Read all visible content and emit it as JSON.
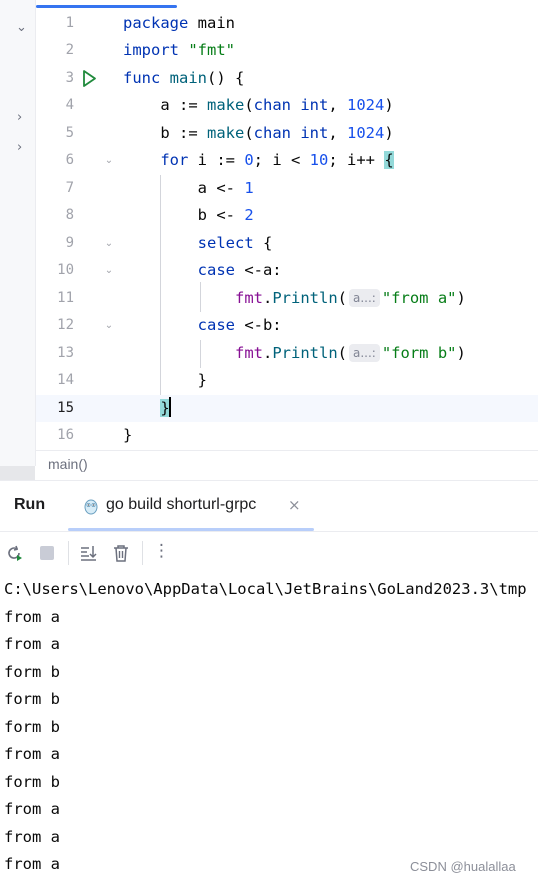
{
  "editor": {
    "line_numbers": [
      "1",
      "2",
      "3",
      "4",
      "5",
      "6",
      "7",
      "8",
      "9",
      "10",
      "11",
      "12",
      "13",
      "14",
      "15",
      "16"
    ],
    "active_line": "15",
    "breadcrumb": "main()",
    "hints": {
      "param_hint": "a...:"
    },
    "code": {
      "l1_kw": "package",
      "l1_rest": " main",
      "l2_kw": "import",
      "l2_str": " \"fmt\"",
      "l3_kw": "func",
      "l3_fn": " main",
      "l3_rest": "() {",
      "l4_a": "    a := ",
      "l4_make": "make",
      "l4_p": "(",
      "l4_chan": "chan",
      "l4_sp": " ",
      "l4_int": "int",
      "l4_comma": ", ",
      "l4_num": "1024",
      "l4_close": ")",
      "l5_a": "    b := ",
      "l5_make": "make",
      "l5_p": "(",
      "l5_chan": "chan",
      "l5_sp": " ",
      "l5_int": "int",
      "l5_comma": ", ",
      "l5_num": "1024",
      "l5_close": ")",
      "l6_ind": "    ",
      "l6_for": "for",
      "l6_a": " i := ",
      "l6_n0": "0",
      "l6_b": "; i < ",
      "l6_n10": "10",
      "l6_c": "; i++ ",
      "l6_brace": "{",
      "l7_a": "        a <- ",
      "l7_n": "1",
      "l8_a": "        b <- ",
      "l8_n": "2",
      "l9_ind": "        ",
      "l9_kw": "select",
      "l9_rest": " {",
      "l10_ind": "        ",
      "l10_kw": "case",
      "l10_rest": " <-a:",
      "l11_ind": "            ",
      "l11_pkg": "fmt",
      "l11_dot": ".",
      "l11_fn": "Println",
      "l11_p": "(",
      "l11_str": "\"from a\"",
      "l11_close": ")",
      "l12_ind": "        ",
      "l12_kw": "case",
      "l12_rest": " <-b:",
      "l13_ind": "            ",
      "l13_pkg": "fmt",
      "l13_dot": ".",
      "l13_fn": "Println",
      "l13_p": "(",
      "l13_str": "\"form b\"",
      "l13_close": ")",
      "l14": "        }",
      "l15_ind": "    ",
      "l15_brace": "}",
      "l16": "}"
    }
  },
  "run_panel": {
    "title": "Run",
    "tab_label": "go build shorturl-grpc",
    "tab_close": "×",
    "toolbar": [
      "rerun-icon",
      "stop-icon",
      "scroll-to-end-icon",
      "clear-icon",
      "more-icon"
    ],
    "more_glyph": "⋮",
    "output": [
      "C:\\Users\\Lenovo\\AppData\\Local\\JetBrains\\GoLand2023.3\\tmp",
      "from a",
      "from a",
      "form b",
      "form b",
      "form b",
      "from a",
      "form b",
      "from a",
      "from a",
      "from a"
    ]
  },
  "watermark": "CSDN @hualallaa",
  "colors": {
    "accent": "#3574f0",
    "keyword": "#0033b3",
    "string": "#067d17",
    "number": "#1750eb",
    "run_green": "#208a3c",
    "brace_highlight": "#93d9d9"
  }
}
